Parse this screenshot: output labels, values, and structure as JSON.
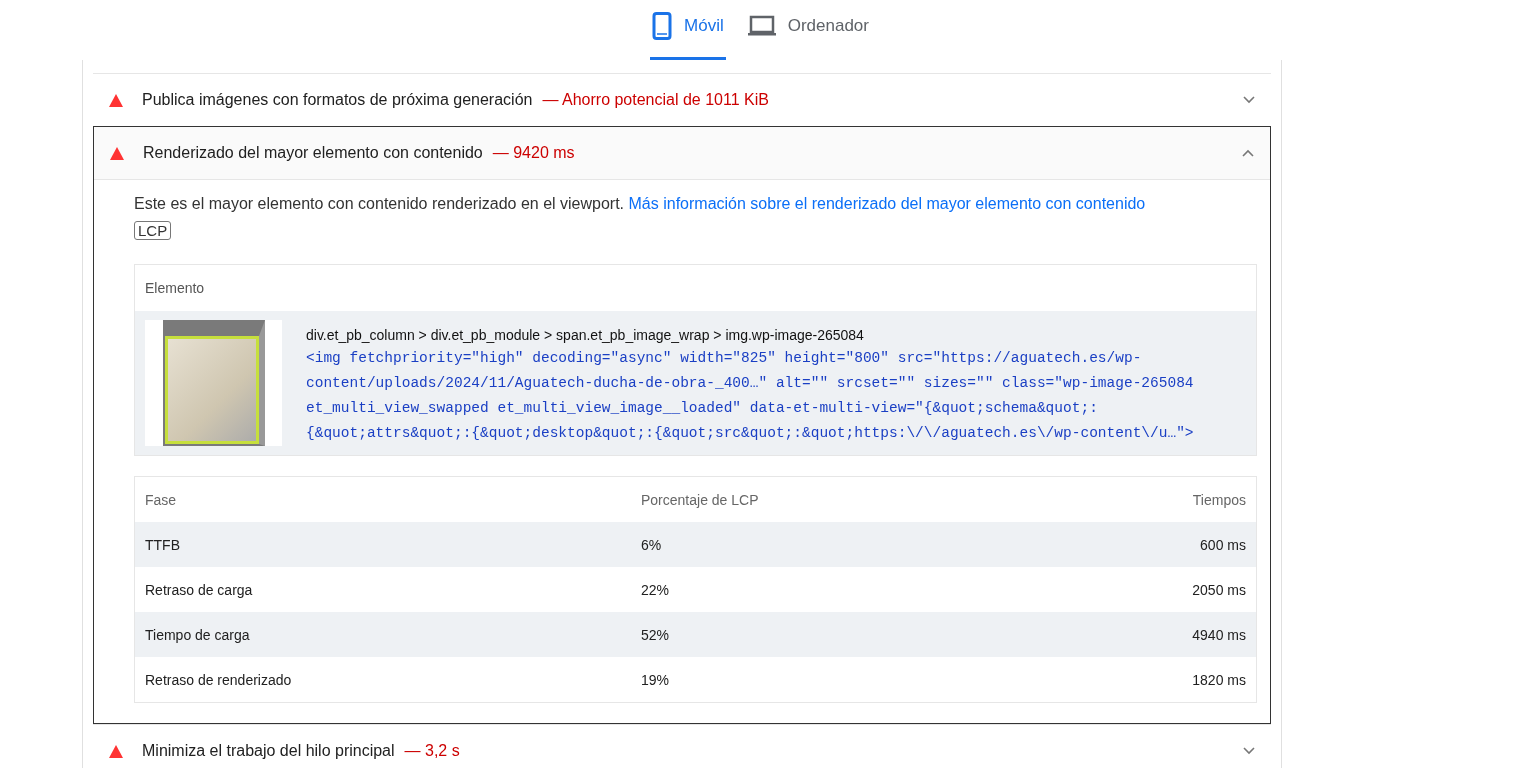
{
  "tabs": [
    {
      "label": "Móvil",
      "kind": "phone",
      "selected": true
    },
    {
      "label": "Ordenador",
      "kind": "laptop",
      "selected": false
    }
  ],
  "audits": [
    {
      "title": "Publica imágenes con formatos de próxima generación",
      "display_value": "— Ahorro potencial de 1011 KiB",
      "expanded": false
    },
    {
      "title": "Renderizado del mayor elemento con contenido",
      "display_value": "— 9420 ms",
      "expanded": true,
      "description": "Este es el mayor elemento con contenido renderizado en el viewport.",
      "link": "Más información sobre el renderizado del mayor elemento con contenido",
      "tag": "LCP",
      "element_table": {
        "heading": "Elemento",
        "selector": "div.et_pb_column > div.et_pb_module > span.et_pb_image_wrap > img.wp-image-265084",
        "snippet": "<img fetchpriority=\"high\" decoding=\"async\" width=\"825\" height=\"800\" src=\"https://aguatech.es/wp-content/uploads/2024/11/Aguatech-ducha-de-obra-_400…\" alt=\"\" srcset=\"\" sizes=\"\" class=\"wp-image-265084 et_multi_view_swapped et_multi_view_image__loaded\" data-et-multi-view=\"{&quot;schema&quot;:{&quot;attrs&quot;:{&quot;desktop&quot;:{&quot;src&quot;:&quot;https:\\/\\/aguatech.es\\/wp-content\\/u…\">"
      },
      "phase_table": {
        "columns": [
          "Fase",
          "Porcentaje de LCP",
          "Tiempos"
        ],
        "rows": [
          [
            "TTFB",
            "6%",
            "600 ms"
          ],
          [
            "Retraso de carga",
            "22%",
            "2050 ms"
          ],
          [
            "Tiempo de carga",
            "52%",
            "4940 ms"
          ],
          [
            "Retraso de renderizado",
            "19%",
            "1820 ms"
          ]
        ]
      }
    },
    {
      "title": "Minimiza el trabajo del hilo principal",
      "display_value": "— 3,2 s",
      "expanded": false
    }
  ]
}
